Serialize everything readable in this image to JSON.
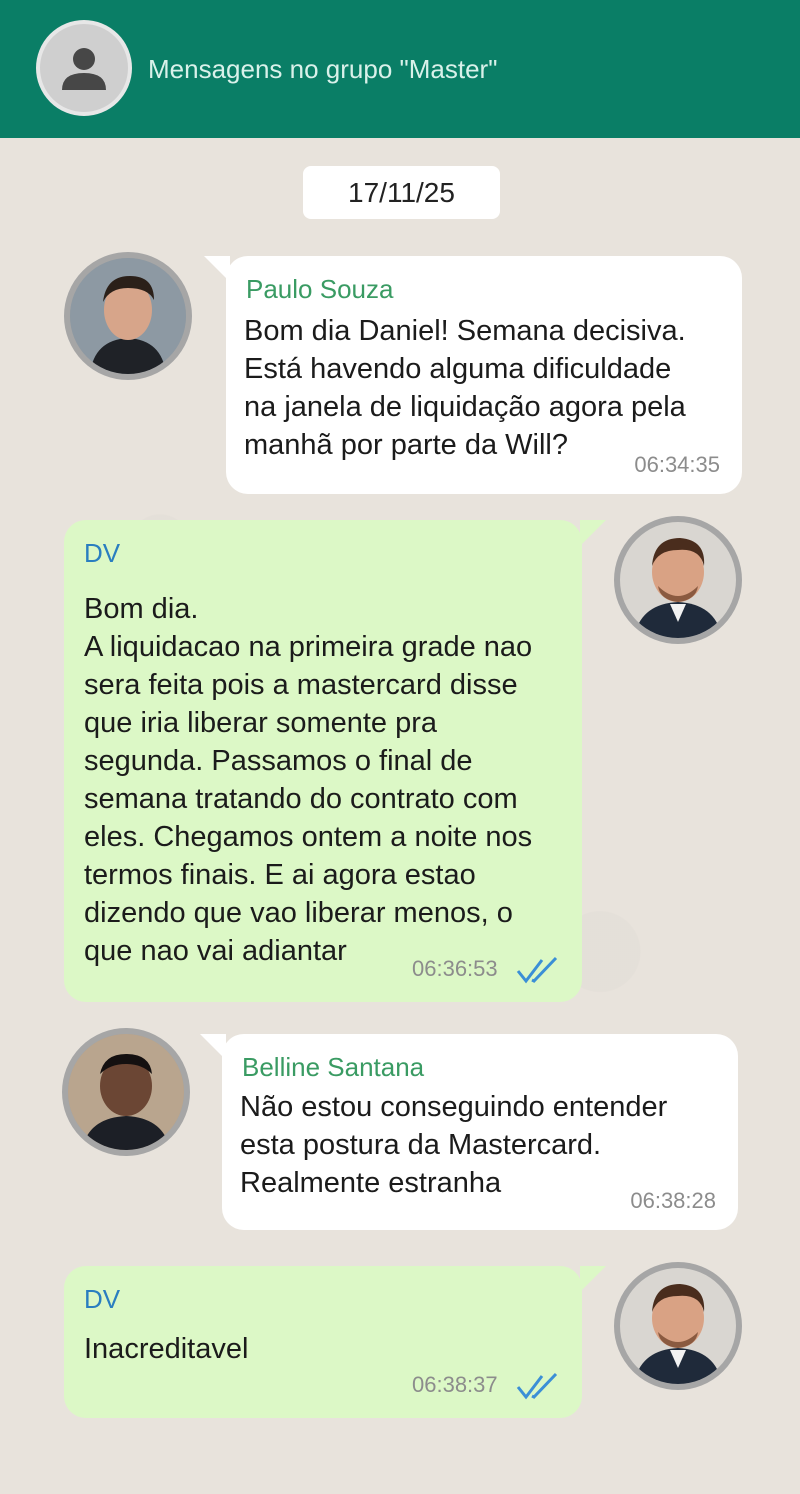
{
  "header": {
    "title": "Mensagens no grupo \"Master\"",
    "avatar_icon": "user-silhouette-icon"
  },
  "date_chip": "17/11/25",
  "messages": [
    {
      "sender": "Paulo Souza",
      "text": "Bom dia Daniel! Semana decisiva.\nEstá havendo alguma dificuldade\nna janela de liquidação agora pela\nmanhã por parte da Will?",
      "time": "06:34:35",
      "direction": "incoming"
    },
    {
      "sender": "DV",
      "text": "Bom dia.\nA liquidacao na primeira grade nao\nsera feita pois a mastercard disse\nque iria liberar somente pra\nsegunda. Passamos o final de\nsemana tratando do contrato com\neles. Chegamos ontem a noite nos\ntermos finais. E ai agora estao\ndizendo que vao liberar menos, o\nque nao vai adiantar",
      "time": "06:36:53",
      "direction": "outgoing"
    },
    {
      "sender": "Belline Santana",
      "text": "Não estou conseguindo entender\nesta postura da Mastercard.\nRealmente estranha",
      "time": "06:38:28",
      "direction": "incoming"
    },
    {
      "sender": "DV",
      "text": "Inacreditavel",
      "time": "06:38:37",
      "direction": "outgoing"
    }
  ],
  "colors": {
    "header": "#0a7e66",
    "incoming_bubble": "#ffffff",
    "outgoing_bubble": "#dcf8c6",
    "incoming_sender": "#3a9b63",
    "outgoing_sender": "#2a7ec0",
    "read_ticks": "#3b8fd6"
  }
}
